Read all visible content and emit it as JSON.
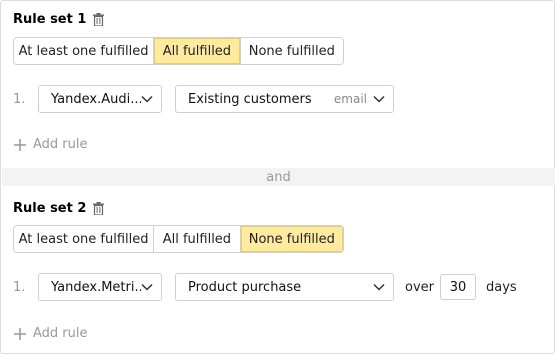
{
  "connector": "and",
  "rule_sets": [
    {
      "title": "Rule set 1",
      "options": [
        "At least one fulfilled",
        "All fulfilled",
        "None fulfilled"
      ],
      "selected": "All fulfilled",
      "rule": {
        "number": "1.",
        "source": "Yandex.Audi...",
        "condition": "Existing customers",
        "condition_hint": "email"
      },
      "add_rule": "Add rule"
    },
    {
      "title": "Rule set 2",
      "options": [
        "At least one fulfilled",
        "All fulfilled",
        "None fulfilled"
      ],
      "selected": "None fulfilled",
      "rule": {
        "number": "1.",
        "source": "Yandex.Metri...",
        "condition": "Product purchase",
        "over_label": "over",
        "days_value": "30",
        "days_label": "days"
      },
      "add_rule": "Add rule"
    }
  ],
  "icons": {
    "trash": "trash-icon",
    "chevron": "chevron-down-icon",
    "plus": "plus-icon"
  },
  "colors": {
    "active_segment": "#ffeba0",
    "muted_text": "#999999",
    "divider_bg": "#f3f3f3"
  }
}
